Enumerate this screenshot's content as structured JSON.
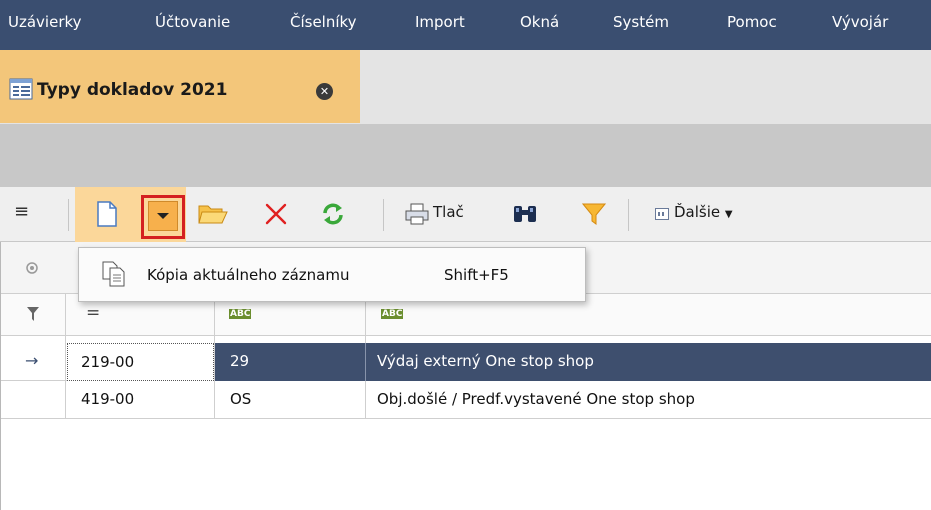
{
  "menu": {
    "items": [
      "Uzávierky",
      "Účtovanie",
      "Číselníky",
      "Import",
      "Okná",
      "Systém",
      "Pomoc",
      "Vývojár"
    ]
  },
  "tab": {
    "title": "Typy dokladov 2021"
  },
  "toolbar": {
    "print_label": "Tlač",
    "more_label": "Ďalšie"
  },
  "dropdown": {
    "item_label": "Kópia aktuálneho záznamu",
    "item_shortcut": "Shift+F5"
  },
  "grid": {
    "filter_row": [
      "=",
      "ABC",
      "ABC"
    ],
    "rows": [
      {
        "col1": "219-00",
        "col2": "29",
        "col3": "Výdaj externý One stop shop",
        "selected": true
      },
      {
        "col1": "419-00",
        "col2": "OS",
        "col3": "Obj.došlé / Predf.vystavené One stop shop",
        "selected": false
      }
    ]
  },
  "colors": {
    "menubar": "#3a4e70",
    "tab_active": "#f3c67a",
    "selection": "#3e4f6e",
    "highlight_outline": "#d42020"
  }
}
